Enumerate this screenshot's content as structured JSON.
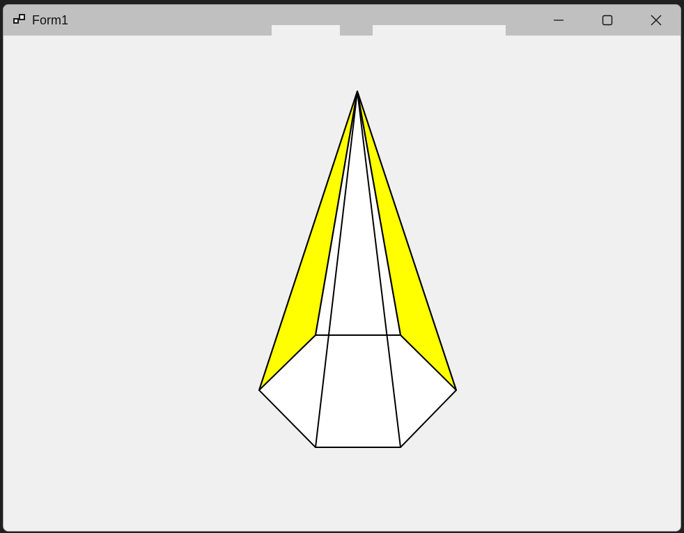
{
  "window": {
    "title": "Form1",
    "icon": "app-form-icon"
  },
  "caption_buttons": [
    {
      "name": "minimize-button",
      "icon": "minimize-icon"
    },
    {
      "name": "maximize-button",
      "icon": "maximize-icon"
    },
    {
      "name": "close-button",
      "icon": "close-icon"
    }
  ],
  "drawing": {
    "shape": "hexagonal-pyramid",
    "fill_face": "#ffff00",
    "fill_base": "#ffffff",
    "stroke": "#000000"
  }
}
